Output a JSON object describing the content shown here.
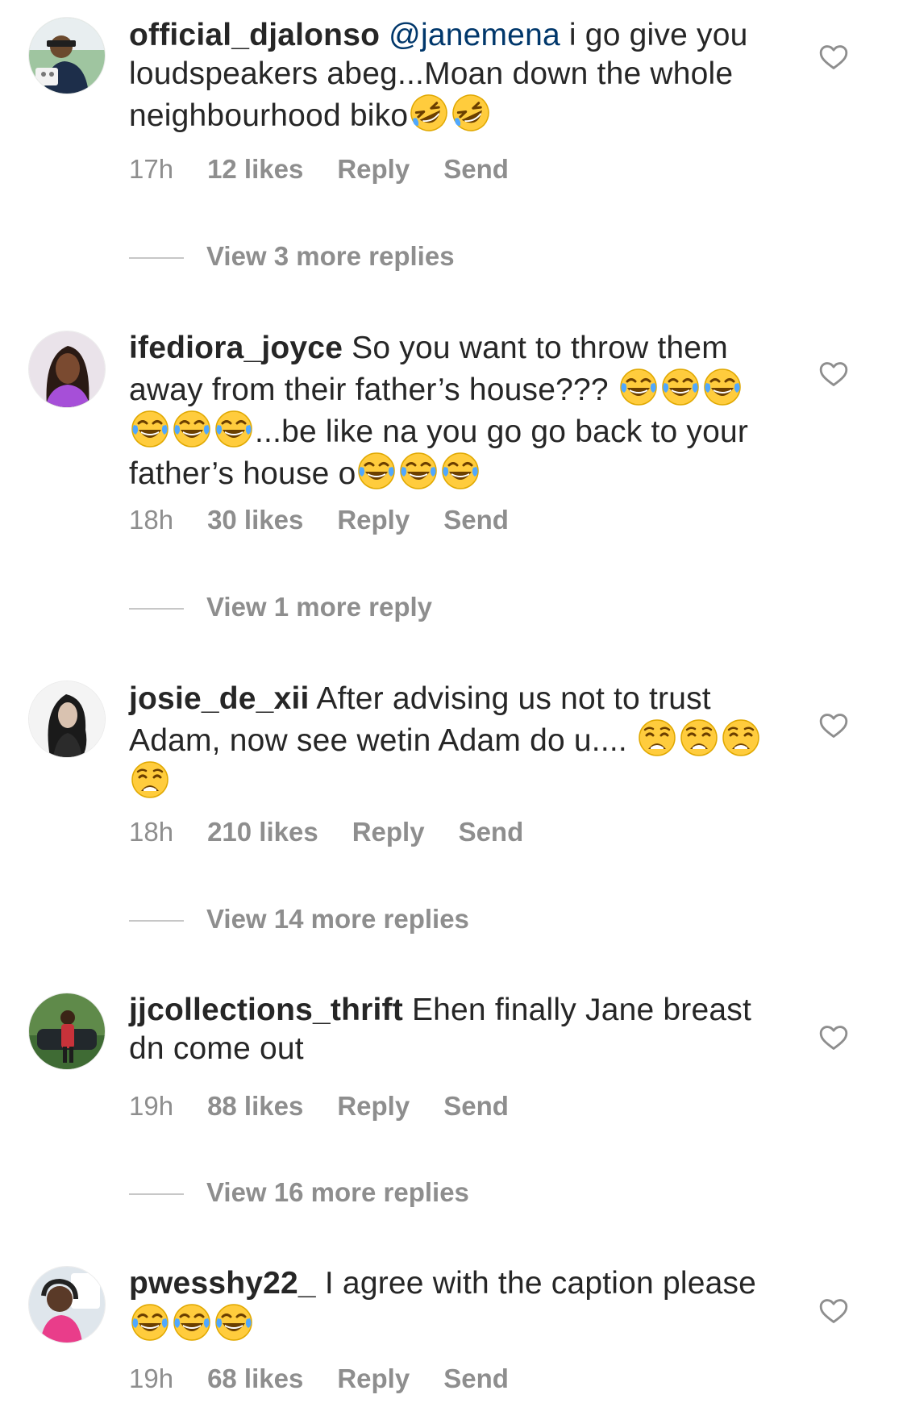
{
  "comments": [
    {
      "username": "official_djalonso",
      "mention": "@janemena",
      "text": "i go give you loudspeakers abeg...Moan down the whole neighbourhood biko",
      "emojis": [
        "rofl",
        "rofl"
      ],
      "time": "17h",
      "likes": "12 likes",
      "reply": "Reply",
      "send": "Send",
      "view_replies": "View 3 more replies",
      "avatar_icon": "avatar-photo-icon"
    },
    {
      "username": "ifediora_joyce",
      "text": "So you want to throw them away from their father’s house???",
      "emojis_a": [
        "joy",
        "joy",
        "joy",
        "joy",
        "joy",
        "joy"
      ],
      "text_b": "...be like na you go go back to your father’s house o",
      "emojis_b": [
        "joy",
        "joy",
        "joy"
      ],
      "time": "18h",
      "likes": "30 likes",
      "reply": "Reply",
      "send": "Send",
      "view_replies": "View 1 more reply",
      "avatar_icon": "avatar-photo-icon"
    },
    {
      "username": "josie_de_xii",
      "text": "After advising us not to trust Adam, now see wetin Adam do u....",
      "emojis": [
        "weary",
        "weary",
        "weary",
        "weary"
      ],
      "time": "18h",
      "likes": "210 likes",
      "reply": "Reply",
      "send": "Send",
      "view_replies": "View 14 more replies",
      "avatar_icon": "avatar-photo-icon"
    },
    {
      "username": "jjcollections_thrift",
      "text": "Ehen finally Jane breast dn come out",
      "time": "19h",
      "likes": "88 likes",
      "reply": "Reply",
      "send": "Send",
      "view_replies": "View 16 more replies",
      "avatar_icon": "avatar-photo-icon"
    },
    {
      "username": "pwesshy22_",
      "text": "I agree with the caption please",
      "emojis": [
        "joy",
        "joy",
        "joy"
      ],
      "time": "19h",
      "likes": "68 likes",
      "reply": "Reply",
      "send": "Send",
      "avatar_icon": "avatar-photo-icon"
    }
  ],
  "icons": {
    "like": "heart-outline-icon",
    "emoji_rofl": "rolling-on-floor-laughing-emoji",
    "emoji_joy": "face-with-tears-of-joy-emoji",
    "emoji_weary": "weary-face-emoji"
  },
  "colors": {
    "text": "#262626",
    "secondary": "#8e8e8e",
    "mention": "#00376b",
    "divider": "#c7c7c7",
    "background": "#ffffff"
  }
}
